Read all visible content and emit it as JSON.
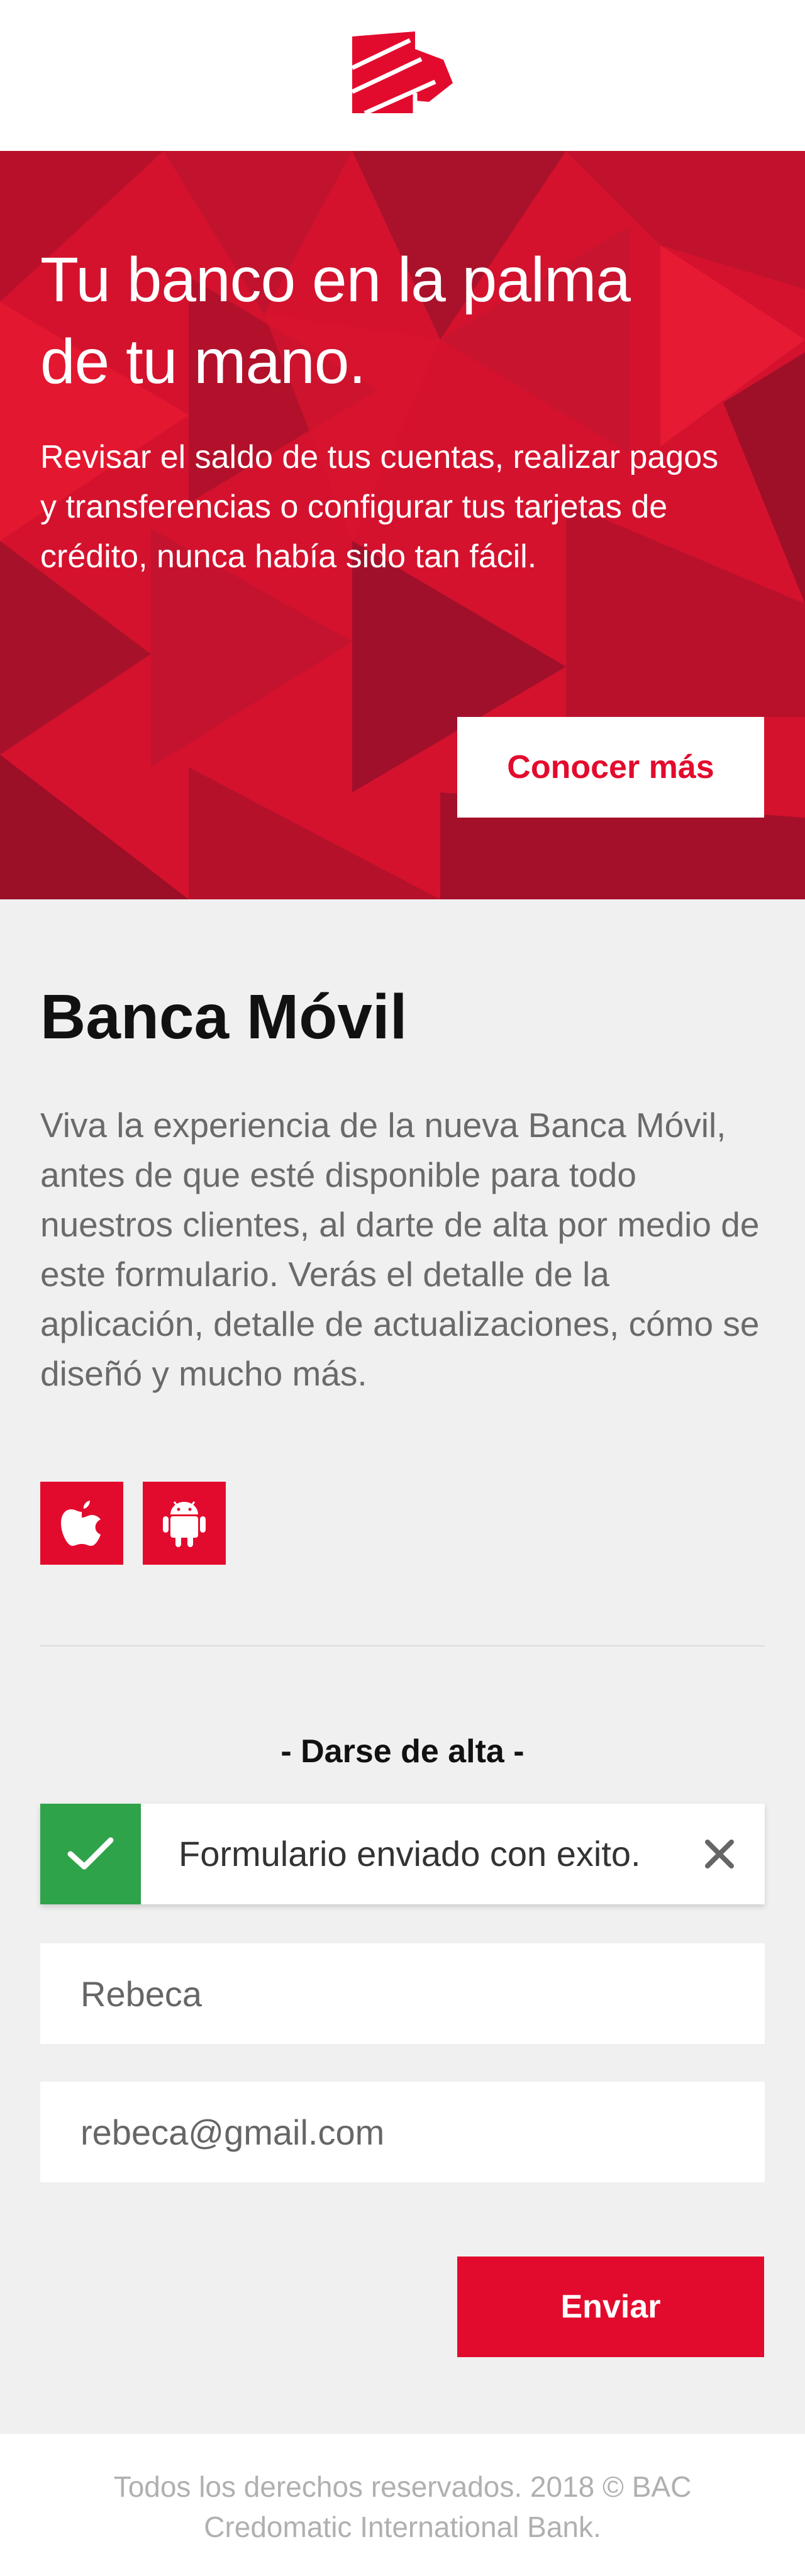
{
  "brand": {
    "accent_color": "#e30b2d",
    "success_color": "#2fa34a",
    "logo_icon": "bac-logo-icon"
  },
  "hero": {
    "title_line1": "Tu banco en la palma",
    "title_line2": "de tu mano.",
    "text": "Revisar el saldo de tus cuentas, realizar pagos y transferencias o configurar tus tarjetas de crédito, nunca había sido tan fácil.",
    "button_label": "Conocer más"
  },
  "main": {
    "title": "Banca Móvil",
    "description": "Viva la experiencia de la nueva Banca Móvil, antes de que esté disponible para todo nuestros clientes, al darte de alta por medio de este formulario. Verás el detalle de la aplicación, detalle de actualizaciones, cómo se diseñó y mucho más.",
    "store_icons": [
      "apple-icon",
      "android-icon"
    ]
  },
  "form": {
    "title": "- Darse de alta -",
    "alert": {
      "text": "Formulario enviado con exito.",
      "icon": "check-icon",
      "close_icon": "close-icon"
    },
    "name_value": "Rebeca",
    "email_value": "rebeca@gmail.com",
    "submit_label": "Enviar"
  },
  "footer": {
    "text": "Todos los derechos reservados. 2018 © BAC Credomatic International Bank."
  }
}
